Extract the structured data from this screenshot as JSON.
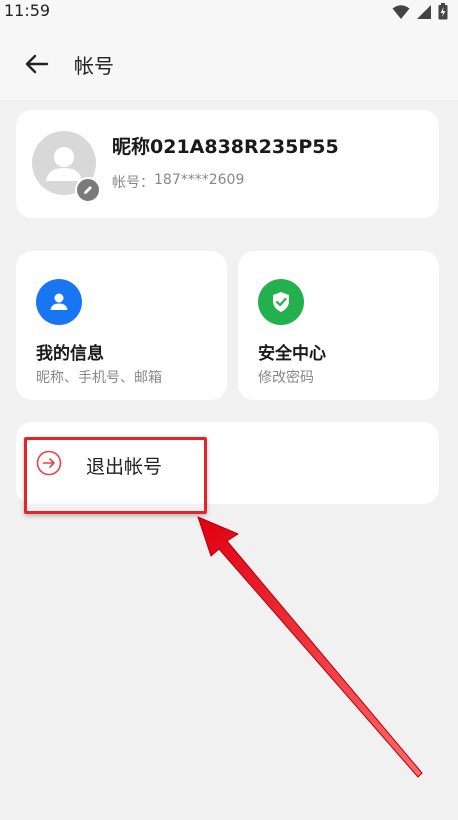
{
  "status_bar": {
    "time": "11:59"
  },
  "header": {
    "title": "帐号"
  },
  "profile": {
    "nickname": "昵称021A838R235P55",
    "account_label": "帐号：",
    "account_value": "187****2609"
  },
  "cards": {
    "my_info": {
      "title": "我的信息",
      "subtitle": "昵称、手机号、邮箱",
      "icon": "person-icon",
      "color": "#1976f2"
    },
    "security": {
      "title": "安全中心",
      "subtitle": "修改密码",
      "icon": "shield-check-icon",
      "color": "#22b14c"
    }
  },
  "logout": {
    "label": "退出帐号",
    "icon": "arrow-right-circle-icon",
    "color": "#e0454d"
  },
  "annotation": {
    "color": "#e3242b"
  }
}
